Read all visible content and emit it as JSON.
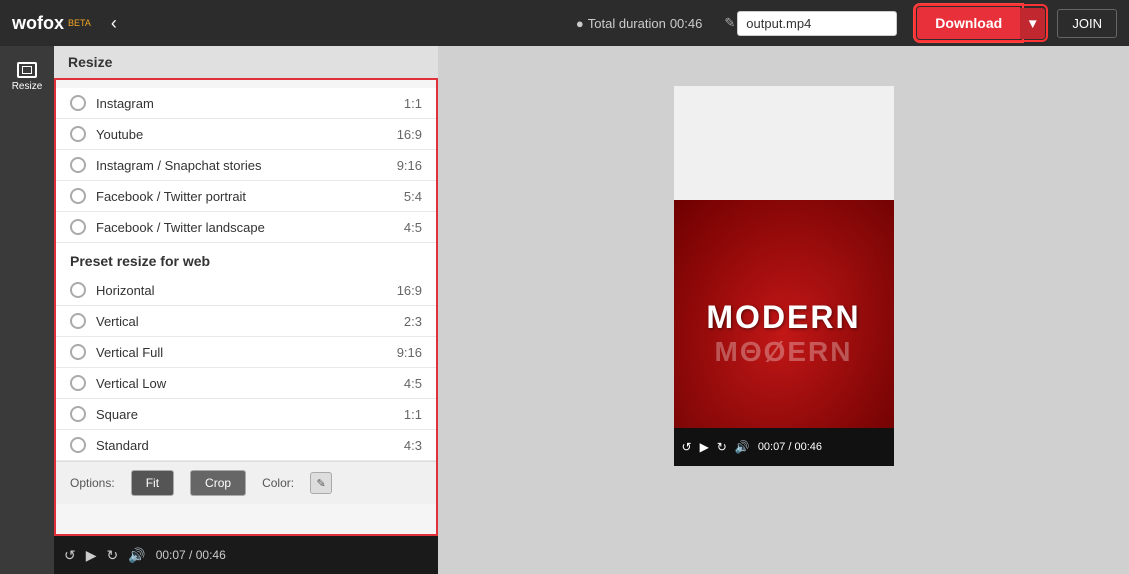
{
  "header": {
    "logo": "wofox",
    "beta": "BETA",
    "total_duration_label": "Total duration",
    "total_duration_value": "00:46",
    "filename": "output.mp4",
    "download_label": "Download",
    "join_label": "JOIN"
  },
  "sidebar": {
    "items": [
      {
        "label": "Resize",
        "icon": "resize-icon"
      }
    ]
  },
  "resize_panel": {
    "title": "Resize",
    "presets_section": {
      "items": [
        {
          "label": "Instagram",
          "ratio": "1:1"
        },
        {
          "label": "Youtube",
          "ratio": "16:9"
        },
        {
          "label": "Instagram / Snapchat stories",
          "ratio": "9:16"
        },
        {
          "label": "Facebook / Twitter portrait",
          "ratio": "5:4"
        },
        {
          "label": "Facebook / Twitter landscape",
          "ratio": "4:5"
        }
      ]
    },
    "web_section": {
      "title": "Preset resize for web",
      "items": [
        {
          "label": "Horizontal",
          "ratio": "16:9"
        },
        {
          "label": "Vertical",
          "ratio": "2:3"
        },
        {
          "label": "Vertical Full",
          "ratio": "9:16"
        },
        {
          "label": "Vertical Low",
          "ratio": "4:5"
        },
        {
          "label": "Square",
          "ratio": "1:1"
        },
        {
          "label": "Standard",
          "ratio": "4:3"
        }
      ]
    },
    "options": {
      "label": "Options:",
      "fit_label": "Fit",
      "crop_label": "Crop",
      "color_label": "Color:"
    }
  },
  "bottom_bar": {
    "time": "00:07 / 00:46"
  },
  "preview": {
    "text_main": "MODERN",
    "text_sub": "M88ERN",
    "bottom_time": "00:07 / 00:46"
  }
}
